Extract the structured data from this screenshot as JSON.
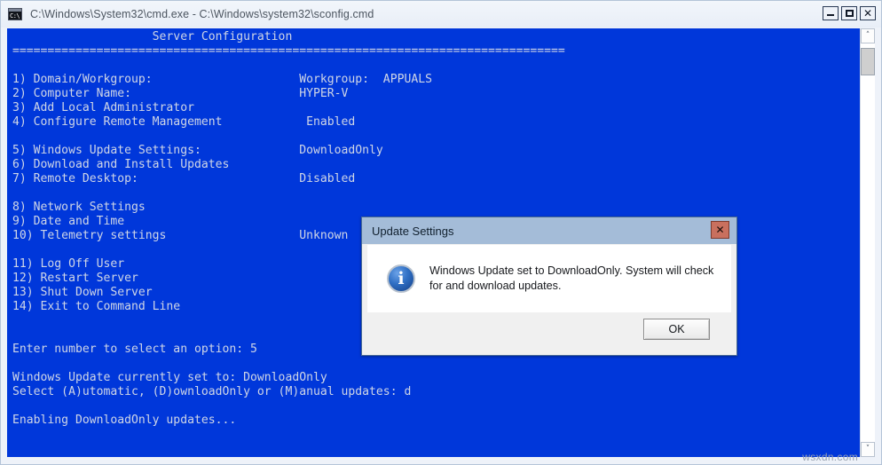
{
  "window": {
    "title": "C:\\Windows\\System32\\cmd.exe - C:\\Windows\\system32\\sconfig.cmd",
    "icon": "cmd-console-icon",
    "icon_glyph": "C:\\",
    "buttons": {
      "minimize": "minimize",
      "maximize": "maximize",
      "close": "✕"
    }
  },
  "console": {
    "background_color": "#0037DA",
    "text_color": "#CFD6E6",
    "header": "                    Server Configuration",
    "separator": "===============================================================================",
    "menu": [
      {
        "num": "1)",
        "label": "Domain/Workgroup:",
        "value": "Workgroup:  APPUALS"
      },
      {
        "num": "2)",
        "label": "Computer Name:",
        "value": "HYPER-V"
      },
      {
        "num": "3)",
        "label": "Add Local Administrator",
        "value": ""
      },
      {
        "num": "4)",
        "label": "Configure Remote Management",
        "value": "Enabled"
      },
      {
        "num": "5)",
        "label": "Windows Update Settings:",
        "value": "DownloadOnly"
      },
      {
        "num": "6)",
        "label": "Download and Install Updates",
        "value": ""
      },
      {
        "num": "7)",
        "label": "Remote Desktop:",
        "value": "Disabled"
      },
      {
        "num": "8)",
        "label": "Network Settings",
        "value": ""
      },
      {
        "num": "9)",
        "label": "Date and Time",
        "value": ""
      },
      {
        "num": "10)",
        "label": "Telemetry settings",
        "value": "Unknown"
      },
      {
        "num": "11)",
        "label": "Log Off User",
        "value": ""
      },
      {
        "num": "12)",
        "label": "Restart Server",
        "value": ""
      },
      {
        "num": "13)",
        "label": "Shut Down Server",
        "value": ""
      },
      {
        "num": "14)",
        "label": "Exit to Command Line",
        "value": ""
      }
    ],
    "prompt_line": "Enter number to select an option: 5",
    "status_line": "Windows Update currently set to: DownloadOnly",
    "select_line": "Select (A)utomatic, (D)ownloadOnly or (M)anual updates: d",
    "enabling_line": "Enabling DownloadOnly updates...",
    "full_text": "                    Server Configuration\n===============================================================================\n\n1) Domain/Workgroup:                     Workgroup:  APPUALS\n2) Computer Name:                        HYPER-V\n3) Add Local Administrator\n4) Configure Remote Management            Enabled\n\n5) Windows Update Settings:              DownloadOnly\n6) Download and Install Updates\n7) Remote Desktop:                       Disabled\n\n8) Network Settings\n9) Date and Time\n10) Telemetry settings                   Unknown\n\n11) Log Off User\n12) Restart Server\n13) Shut Down Server\n14) Exit to Command Line\n\n\nEnter number to select an option: 5\n\nWindows Update currently set to: DownloadOnly\nSelect (A)utomatic, (D)ownloadOnly or (M)anual updates: d\n\nEnabling DownloadOnly updates..."
  },
  "scrollbar": {
    "up_arrow": "˄",
    "down_arrow": "˅"
  },
  "dialog": {
    "title": "Update Settings",
    "close_label": "✕",
    "icon": "information-icon",
    "message": "Windows Update set to DownloadOnly.  System will check for and download updates.",
    "ok_label": "OK"
  },
  "watermark": {
    "text": "wsxdn.com"
  }
}
